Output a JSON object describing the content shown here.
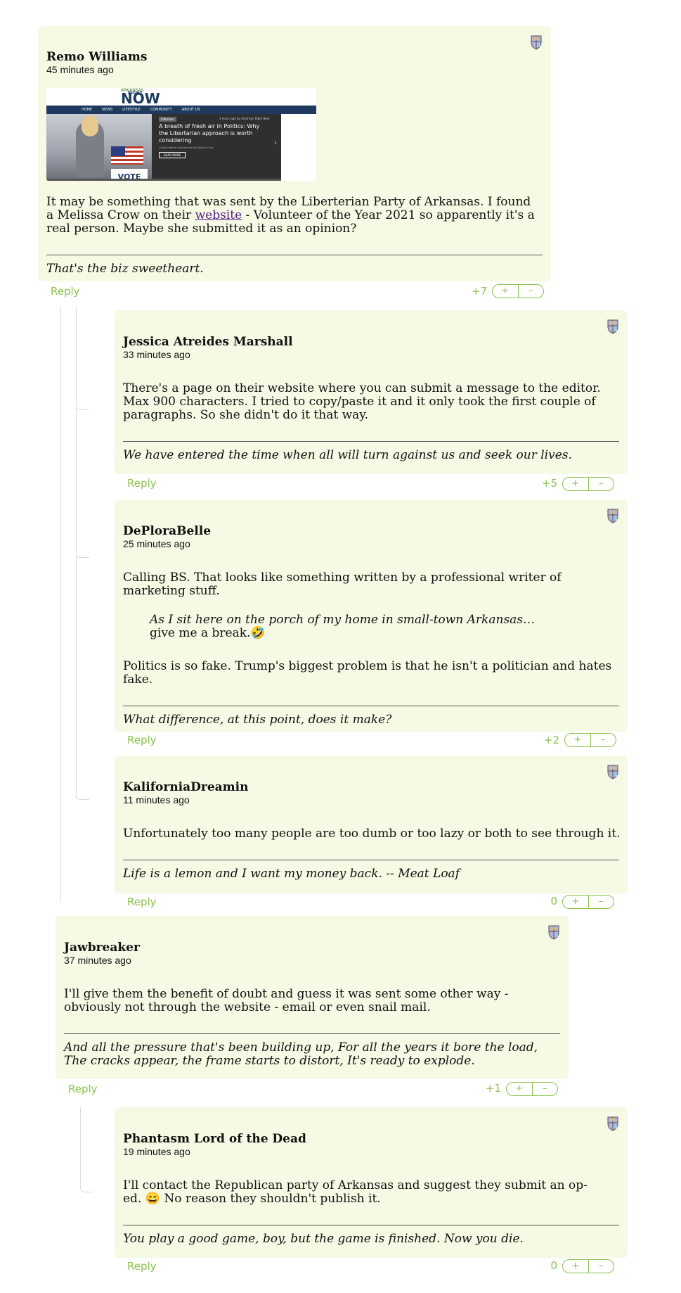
{
  "reply_label": "Reply",
  "vote_up": "+",
  "vote_down": "–",
  "accent_color": "#8bc34a",
  "card_color": "#f6f9e4",
  "comments": [
    {
      "author": "Remo Williams",
      "time": "45 minutes ago",
      "image": {
        "site_tagline": "ARKANSAS",
        "site_logo_top": "RIGHT",
        "site_logo_bottom": "NOW",
        "nav": [
          "HOME",
          "NEWS",
          "LIFESTYLE",
          "COMMUNITY",
          "ABOUT US"
        ],
        "tag": "Editorials",
        "byline": "3 hours ago by Arkansas Right Now",
        "headline": "A breath of fresh air in Politics: Why the Libertarian approach is worth considering",
        "subline": "Guest Editorial contribution by Melissa Crow",
        "button": "READ MORE",
        "sign": "VOTE"
      },
      "body_before_link": "It may be something that was sent by the Liberterian Party of Arkansas. I found a Melissa Crow on their ",
      "link_text": "website",
      "body_after_link": " - Volunteer of the Year 2021 so apparently it's a real person. Maybe she submitted it as an opinion?",
      "signature": "That's the biz sweetheart.",
      "score": "+7"
    },
    {
      "author": "Jessica Atreides Marshall",
      "time": "33 minutes ago",
      "body": "There's a page on their website where you can submit a message to the editor. Max 900 characters. I tried to copy/paste it and it only took the first couple of paragraphs. So she didn't do it that way.",
      "signature": "We have entered the time when all will turn against us and seek our lives.",
      "score": "+5"
    },
    {
      "author": "DePloraBelle",
      "time": "25 minutes ago",
      "body": "Calling BS. That looks like something written by a professional writer of marketing stuff.",
      "quote_italic": "As I sit here on the porch of my home in small-town Arkansas…",
      "quote_rest": " give me a break.🤣",
      "body2": "Politics is so fake. Trump's biggest problem is that he isn't a politician and hates fake.",
      "signature": "What difference, at this point, does it make?",
      "score": "+2"
    },
    {
      "author": "KaliforniaDreamin",
      "time": "11 minutes ago",
      "body": "Unfortunately too many people are too dumb or too lazy or both to see through it.",
      "signature": "Life is a lemon and I want my money back. -- Meat Loaf",
      "score": "0"
    },
    {
      "author": "Jawbreaker",
      "time": "37 minutes ago",
      "body": "I'll give them the benefit of doubt and guess it was sent some other way - obviously not through the website - email or even snail mail.",
      "signature": "And all the pressure that's been building up, For all the years it bore the load, The cracks appear, the frame starts to distort, It's ready to explode.",
      "score": "+1"
    },
    {
      "author": "Phantasm Lord of the Dead",
      "time": "19 minutes ago",
      "body": "I'll contact the Republican party of Arkansas and suggest they submit an op-ed. 😄 No reason they shouldn't publish it.",
      "signature": "You play a good game, boy, but the game is finished. Now you die.",
      "score": "0"
    }
  ]
}
